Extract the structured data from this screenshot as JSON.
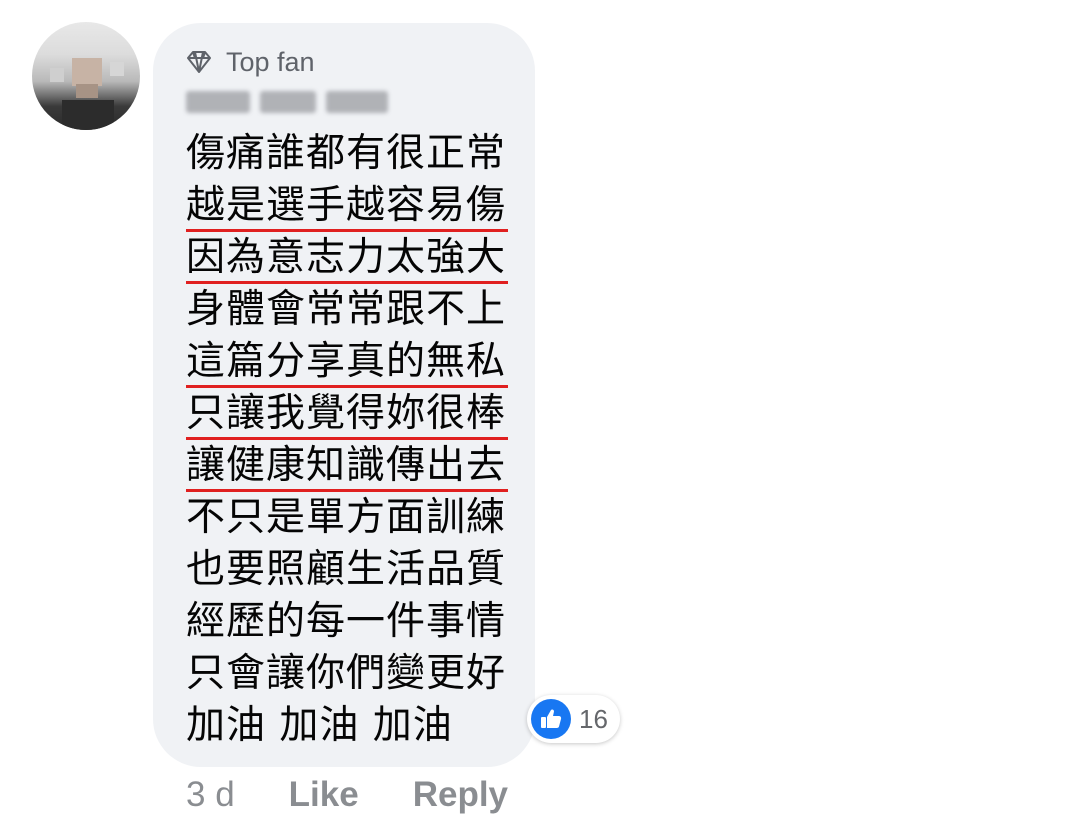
{
  "comment": {
    "badge_label": "Top fan",
    "lines": [
      {
        "text": "傷痛誰都有很正常",
        "underlined": false
      },
      {
        "text": "越是選手越容易傷",
        "underlined": true
      },
      {
        "text": "因為意志力太強大",
        "underlined": true
      },
      {
        "text": "身體會常常跟不上",
        "underlined": false
      },
      {
        "text": "這篇分享真的無私",
        "underlined": true
      },
      {
        "text": "只讓我覺得妳很棒",
        "underlined": true
      },
      {
        "text": "讓健康知識傳出去",
        "underlined": true
      },
      {
        "text": "不只是單方面訓練",
        "underlined": false
      },
      {
        "text": "也要照顧生活品質",
        "underlined": false
      },
      {
        "text": "經歷的每一件事情",
        "underlined": false
      },
      {
        "text": "只會讓你們變更好",
        "underlined": false
      },
      {
        "text": "加油 加油 加油",
        "underlined": false
      }
    ],
    "reaction": {
      "icon": "thumbs-up-icon",
      "count": "16"
    },
    "timestamp": "3 d",
    "actions": {
      "like": "Like",
      "reply": "Reply"
    }
  },
  "colors": {
    "bubble_bg": "#f0f2f5",
    "text": "#050505",
    "meta_text": "#8a8d91",
    "underline": "#e02020",
    "like_blue": "#1877f2"
  }
}
